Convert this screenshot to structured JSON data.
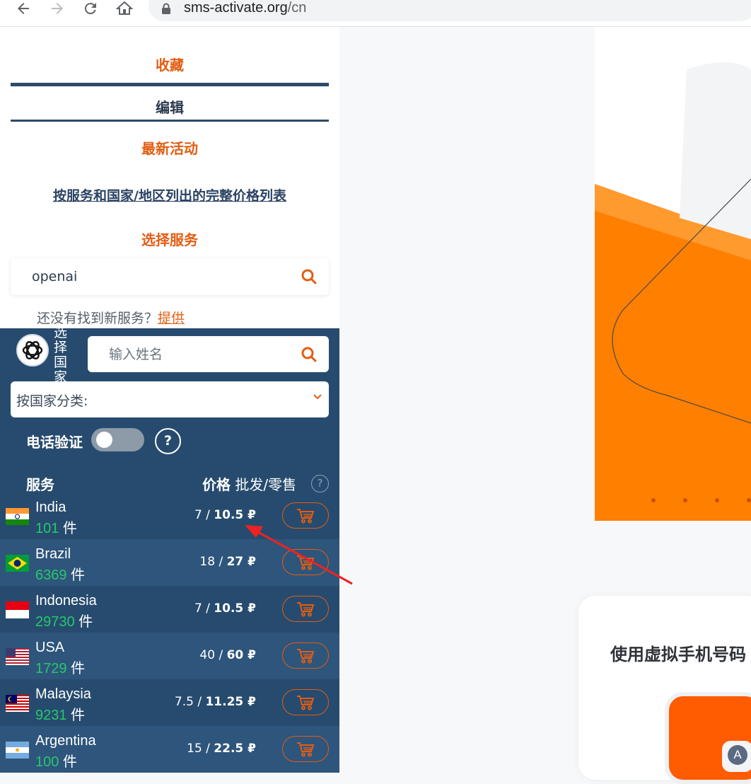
{
  "browser": {
    "url_host": "sms-activate.org",
    "url_path": "/cn"
  },
  "left_menu": {
    "favorites": "收藏",
    "edit": "编辑",
    "latest_activity": "最新活动",
    "full_price_list": "按服务和国家/地区列出的完整价格列表",
    "choose_service": "选择服务",
    "service_search_value": "openai",
    "not_found_text": "还没有找到新服务？",
    "offer_link": "提供"
  },
  "country_panel": {
    "vertical_label": "选择国家",
    "name_search_placeholder": "输入姓名",
    "sort_label": "按国家分类:",
    "phone_verification_label": "电话验证",
    "help_mark": "?",
    "header_service": "服务",
    "header_price_bold": "价格",
    "header_price_rest": " 批发/零售",
    "header_help": "?"
  },
  "countries": [
    {
      "name": "India",
      "count": "101",
      "unit": " 件",
      "price_wholesale": "7 / ",
      "price_retail": "10.5 ₽"
    },
    {
      "name": "Brazil",
      "count": "6369",
      "unit": " 件",
      "price_wholesale": "18 / ",
      "price_retail": "27 ₽"
    },
    {
      "name": "Indonesia",
      "count": "29730",
      "unit": " 件",
      "price_wholesale": "7 / ",
      "price_retail": "10.5 ₽"
    },
    {
      "name": "USA",
      "count": "1729",
      "unit": " 件",
      "price_wholesale": "40 / ",
      "price_retail": "60 ₽"
    },
    {
      "name": "Malaysia",
      "count": "9231",
      "unit": " 件",
      "price_wholesale": "7.5 / ",
      "price_retail": "11.25 ₽"
    },
    {
      "name": "Argentina",
      "count": "100",
      "unit": " 件",
      "price_wholesale": "15 / ",
      "price_retail": "22.5 ₽"
    }
  ],
  "right": {
    "card_title": "使用虚拟手机号码",
    "avatar_letter": "A"
  },
  "colors": {
    "accent_orange": "#e35d13",
    "panel_dark": "#264b6e",
    "count_green": "#28c76f",
    "hero_orange": "#ff7f00"
  }
}
